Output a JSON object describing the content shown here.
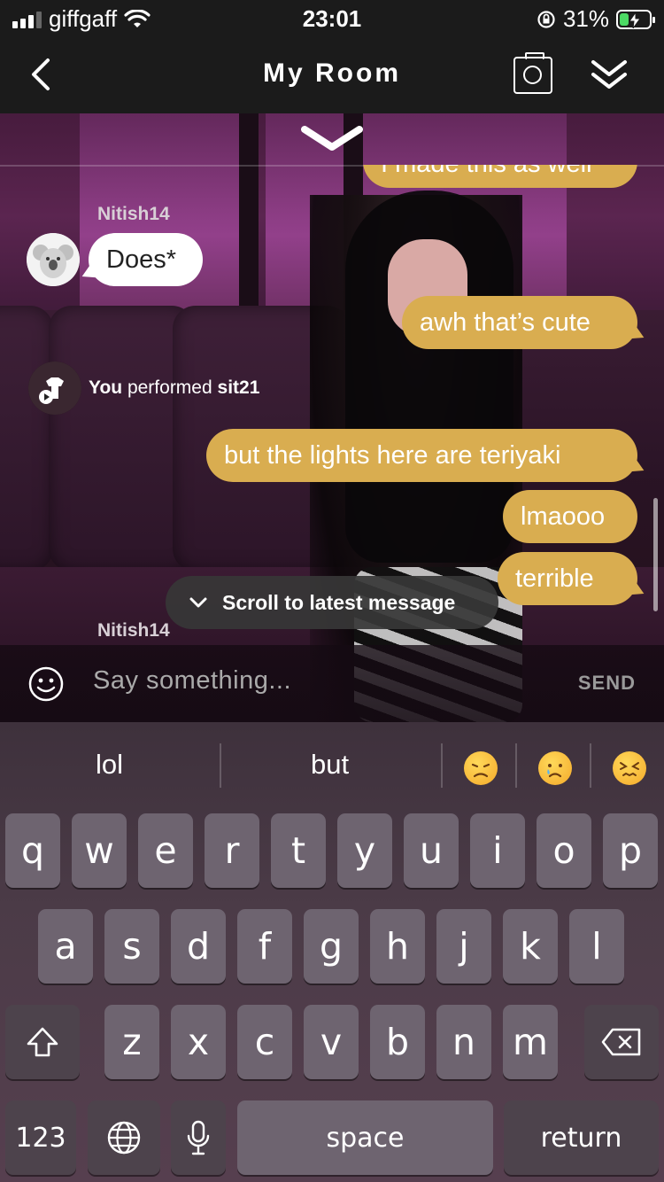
{
  "status_bar": {
    "carrier": "giffgaff",
    "time": "23:01",
    "battery_pct": "31%",
    "battery_level": 0.31,
    "wifi_icon": "wifi-icon",
    "lock_icon": "orientation-lock-icon"
  },
  "nav": {
    "title": "My Room",
    "back_icon": "chevron-left-icon",
    "camera_icon": "camera-icon",
    "collapse_icon": "double-chevron-down-icon"
  },
  "chat": {
    "partial_message": "I made this as well",
    "user1": "Nitish14",
    "msg_does": "Does*",
    "msg_cute": "awh that’s cute",
    "action_you": "You",
    "action_verb": "performed",
    "action_name": "sit21",
    "msg_lights": "but the lights here are teriyaki",
    "msg_lmao": "lmaooo",
    "msg_terrible": "terrible",
    "user2": "Nitish14",
    "scroll_latest": "Scroll to latest message"
  },
  "input": {
    "placeholder": "Say something...",
    "send": "SEND"
  },
  "keyboard": {
    "suggestions": [
      "lol",
      "but"
    ],
    "emojis": [
      "disappointed-face-emoji",
      "crying-face-emoji",
      "confounded-face-emoji"
    ],
    "row1": [
      "q",
      "w",
      "e",
      "r",
      "t",
      "y",
      "u",
      "i",
      "o",
      "p"
    ],
    "row2": [
      "a",
      "s",
      "d",
      "f",
      "g",
      "h",
      "j",
      "k",
      "l"
    ],
    "row3": [
      "z",
      "x",
      "c",
      "v",
      "b",
      "n",
      "m"
    ],
    "numbers": "123",
    "space": "space",
    "return": "return"
  },
  "colors": {
    "my_bubble": "#d9ad50",
    "their_bubble": "#ffffff",
    "bar": "#1b1b1b"
  }
}
